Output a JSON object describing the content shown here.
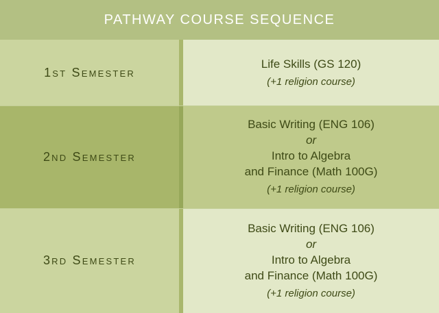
{
  "title": "PATHWAY COURSE SEQUENCE",
  "rows": [
    {
      "semester": "1st Semester",
      "lines": [
        "Life Skills (GS 120)"
      ],
      "note": "(+1 religion course)"
    },
    {
      "semester": "2nd Semester",
      "lines": [
        "Basic Writing (ENG 106)",
        "or",
        "Intro to Algebra",
        "and Finance (Math 100G)"
      ],
      "note": "(+1 religion course)"
    },
    {
      "semester": "3rd Semester",
      "lines": [
        "Basic Writing (ENG 106)",
        "or",
        "Intro to Algebra",
        "and Finance (Math 100G)"
      ],
      "note": "(+1 religion course)"
    }
  ],
  "colors": {
    "header_bg": "#b3c083",
    "text": "#3e4a16",
    "light_cell": "#e2e8c8",
    "mid_cell": "#cbd59f",
    "dark_cell": "#a8b66a"
  }
}
